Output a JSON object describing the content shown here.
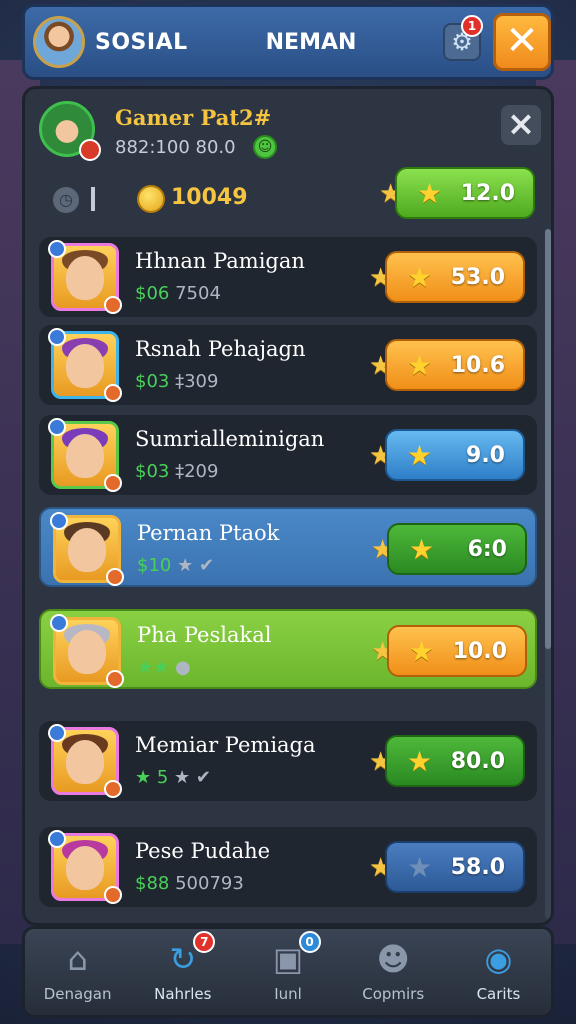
{
  "top_bar": {
    "title": "SOSIAL",
    "subtitle": "NEMAN",
    "settings_badge": "1"
  },
  "profile": {
    "name": "Gamer Pat2#",
    "code": "882:100 80.0",
    "coins": "10049",
    "star_value": "12.0",
    "star_color": "#5fbe2a"
  },
  "friends": [
    {
      "name": "Hhnan Pamigan",
      "sub_green": "$06",
      "sub_rest": "7504",
      "stars": "53.0",
      "button": "orange",
      "hair": "#7a4a26",
      "style": "dark"
    },
    {
      "name": "Rsnah Pehajagn",
      "sub_green": "$03",
      "sub_rest": "‡309",
      "stars": "10.6",
      "button": "orange",
      "hair": "#8a3fb0",
      "style": "dark"
    },
    {
      "name": "Sumrialleminigan",
      "sub_green": "$03",
      "sub_rest": "‡209",
      "stars": "9.0",
      "button": "blue",
      "hair": "#7a3cb8",
      "style": "dark"
    },
    {
      "name": "Pernan Ptaok",
      "sub_green": "$10",
      "sub_rest": "★ ✔",
      "stars": "6:0",
      "button": "dkgreen",
      "hair": "#5a3a22",
      "style": "blue"
    },
    {
      "name": "Pha Peslakal",
      "sub_green": "★★",
      "sub_rest": "●",
      "stars": "10.0",
      "button": "orange",
      "hair": "#b8b8c4",
      "style": "green"
    },
    {
      "name": "Memiar Pemiaga",
      "sub_green": "★ 5",
      "sub_rest": "★ ✔",
      "stars": "80.0",
      "button": "dkgreen",
      "hair": "#6a3a1e",
      "style": "dark"
    },
    {
      "name": "Pese Pudahe",
      "sub_green": "$88",
      "sub_rest": "500793",
      "stars": "58.0",
      "button": "steel",
      "hair": "#b83a9e",
      "style": "dark"
    }
  ],
  "nav": [
    {
      "label": "Denagan",
      "icon": "home-icon",
      "glyph": "⌂"
    },
    {
      "label": "Nahrles",
      "icon": "refresh-icon",
      "glyph": "↻",
      "badge": "7",
      "active": true
    },
    {
      "label": "Iunl",
      "icon": "document-icon",
      "glyph": "▣",
      "badge": "0"
    },
    {
      "label": "Copmirs",
      "icon": "friends-icon",
      "glyph": "☻"
    },
    {
      "label": "Carits",
      "icon": "compass-icon",
      "glyph": "◉",
      "active": true
    }
  ]
}
